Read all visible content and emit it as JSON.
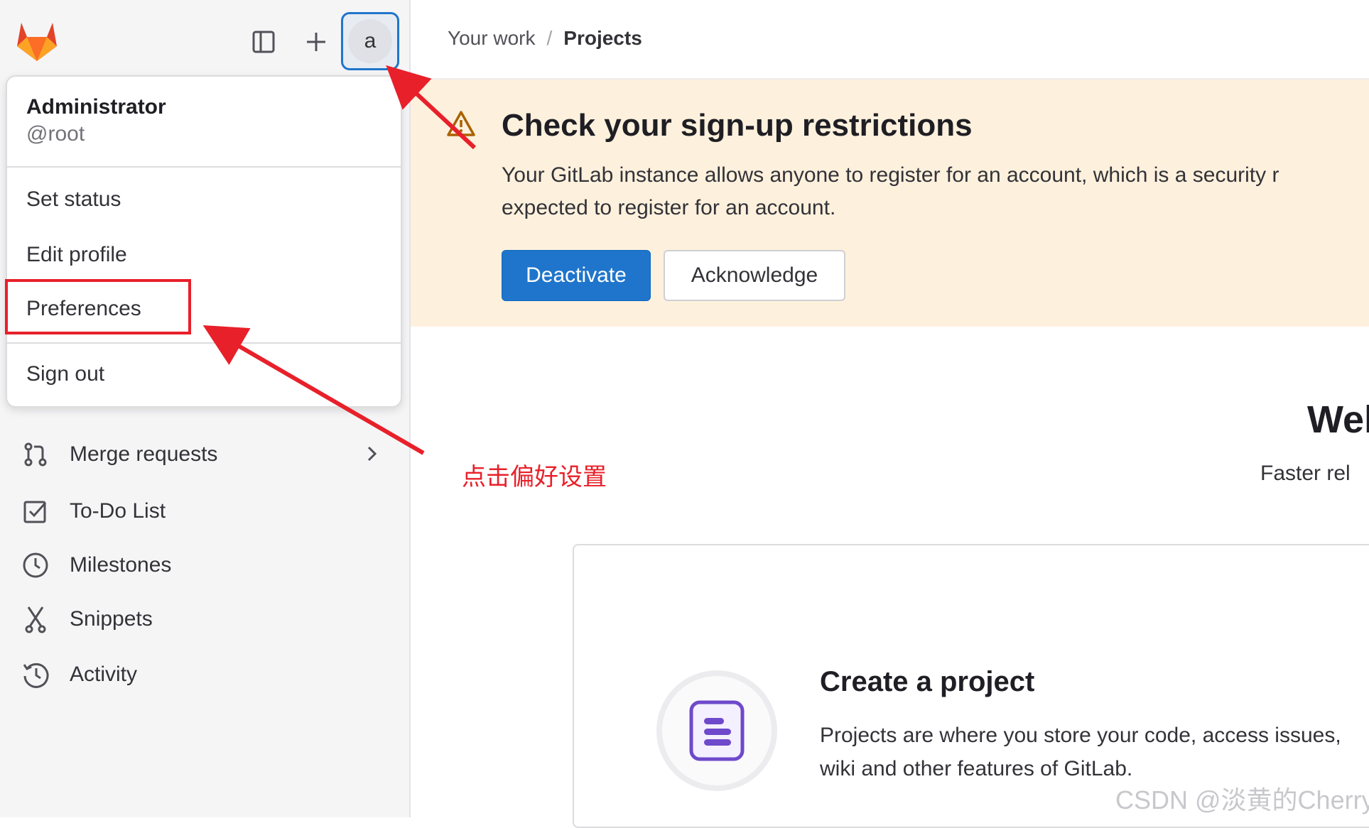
{
  "header": {
    "breadcrumb": [
      "Your work",
      "Projects"
    ],
    "breadcrumb_sep": "/"
  },
  "user_menu": {
    "name": "Administrator",
    "handle": "@root",
    "items": [
      "Set status",
      "Edit profile",
      "Preferences",
      "Sign out"
    ],
    "avatar_text": "a"
  },
  "sidebar": {
    "items": [
      {
        "label": "Merge requests",
        "icon": "merge-request-icon"
      },
      {
        "label": "To-Do List",
        "icon": "todo-icon"
      },
      {
        "label": "Milestones",
        "icon": "clock-icon"
      },
      {
        "label": "Snippets",
        "icon": "scissors-icon"
      },
      {
        "label": "Activity",
        "icon": "history-icon"
      }
    ]
  },
  "banner": {
    "title": "Check your sign-up restrictions",
    "text_line1": "Your GitLab instance allows anyone to register for an account, which is a security r",
    "text_line2": "expected to register for an account.",
    "primary_button": "Deactivate",
    "secondary_button": "Acknowledge"
  },
  "welcome": {
    "title": "Wel",
    "subtitle": "Faster rel"
  },
  "card": {
    "title": "Create a project",
    "text": "Projects are where you store your code, access issues, wiki and other features of GitLab."
  },
  "annotation": {
    "text": "点击偏好设置",
    "color": "#e8202a"
  },
  "watermark": "CSDN @淡黄的Cherry",
  "colors": {
    "accent": "#1f75cb",
    "banner_bg": "#fdf1dd",
    "logo": "#e24329"
  }
}
